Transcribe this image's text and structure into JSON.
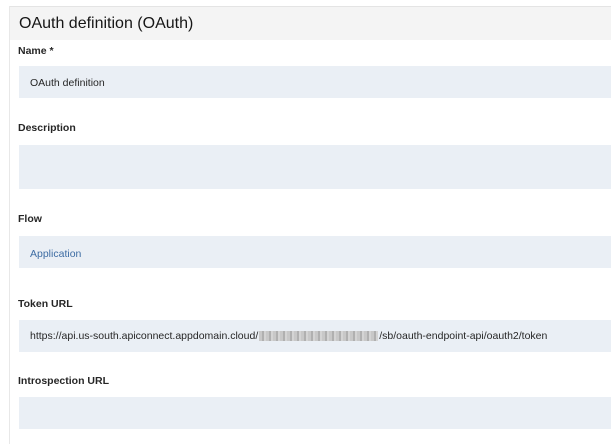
{
  "page": {
    "title": "OAuth definition (OAuth)"
  },
  "fields": {
    "name": {
      "label": "Name *",
      "value": "OAuth definition"
    },
    "description": {
      "label": "Description",
      "value": ""
    },
    "flow": {
      "label": "Flow",
      "value": "Application"
    },
    "token_url": {
      "label": "Token URL",
      "value_prefix": "https://api.us-south.apiconnect.appdomain.cloud/",
      "value_suffix": "/sb/oauth-endpoint-api/oauth2/token"
    },
    "introspection_url": {
      "label": "Introspection URL",
      "value": ""
    }
  },
  "colors": {
    "field_background": "#eaeff5",
    "header_background": "#f4f4f4",
    "link_text": "#3d6ca3"
  }
}
